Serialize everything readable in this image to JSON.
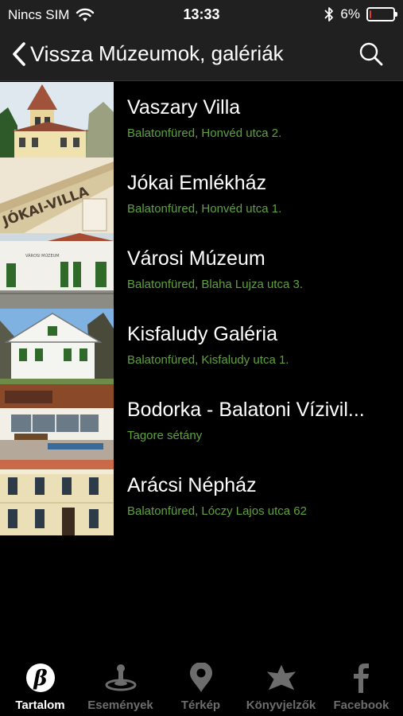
{
  "status_bar": {
    "carrier": "Nincs SIM",
    "time": "13:33",
    "battery_percent_label": "6%",
    "battery_level": 0.06,
    "battery_color": "#e23b2e"
  },
  "nav": {
    "back_label": "Vissza",
    "title": "Múzeumok, galériák",
    "search_icon": "search-icon"
  },
  "items": [
    {
      "title": "Vaszary Villa",
      "address": "Balatonfüred, Honvéd utca 2."
    },
    {
      "title": "Jókai Emlékház",
      "address": "Balatonfüred, Honvéd utca 1."
    },
    {
      "title": "Városi Múzeum",
      "address": "Balatonfüred, Blaha Lujza utca 3."
    },
    {
      "title": "Kisfaludy Galéria",
      "address": "Balatonfüred, Kisfaludy utca 1."
    },
    {
      "title": "Bodorka - Balatoni Vízivil...",
      "address": "Tagore sétány"
    },
    {
      "title": "Arácsi Népház",
      "address": "Balatonfüred, Lóczy Lajos utca 62"
    }
  ],
  "thumb_texts": {
    "jokai_sign": "JÓKAI-VILLA",
    "muzeum_sign": "VÁROSI MÚZEUM"
  },
  "tabs": [
    {
      "label": "Tartalom",
      "icon": "beta-logo-icon",
      "active": true
    },
    {
      "label": "Események",
      "icon": "joystick-icon",
      "active": false
    },
    {
      "label": "Térkép",
      "icon": "map-pin-icon",
      "active": false
    },
    {
      "label": "Könyvjelzők",
      "icon": "star-icon",
      "active": false
    },
    {
      "label": "Facebook",
      "icon": "facebook-icon",
      "active": false
    }
  ],
  "colors": {
    "address_green": "#5ea33c",
    "bar_background": "#202020",
    "inactive_tab": "#6d6d6d"
  }
}
